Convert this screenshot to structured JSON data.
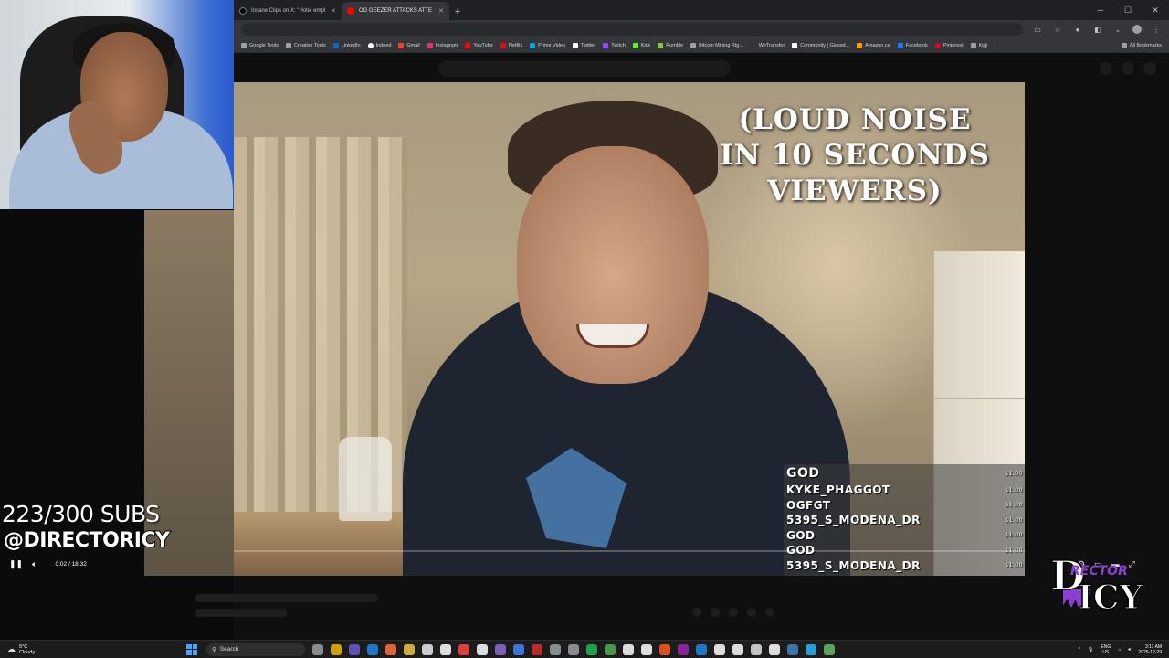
{
  "browser": {
    "tabs": [
      {
        "label": "Insane Clips on X: \"Hotel empl",
        "favicon_color": "#000000",
        "active": false
      },
      {
        "label": "OG GEEZER ATTACKS ATTE",
        "favicon_color": "#ff0000",
        "active": true
      }
    ],
    "new_tab": "+",
    "bookmarks": [
      {
        "label": "Google Tools",
        "color": "#9aa0a6"
      },
      {
        "label": "Creative Tools",
        "color": "#9aa0a6"
      },
      {
        "label": "LinkedIn",
        "color": "#0a66c2"
      },
      {
        "label": "Indeed",
        "color": "#ffffff"
      },
      {
        "label": "Gmail",
        "color": "#ea4335"
      },
      {
        "label": "Instagram",
        "color": "#e1306c"
      },
      {
        "label": "YouTube",
        "color": "#ff0000"
      },
      {
        "label": "Netflix",
        "color": "#e50914"
      },
      {
        "label": "Prime Video",
        "color": "#00a8e1"
      },
      {
        "label": "Twitter",
        "color": "#ffffff"
      },
      {
        "label": "Twitch",
        "color": "#9146ff"
      },
      {
        "label": "Kick",
        "color": "#53fc18"
      },
      {
        "label": "Rumble",
        "color": "#85c742"
      },
      {
        "label": "Bitcoin Mining Rig...",
        "color": "#9aa0a6"
      },
      {
        "label": "WeTransfer",
        "color": "#9aa0a6"
      },
      {
        "label": "Community | Glassd...",
        "color": "#ffffff"
      },
      {
        "label": "Amazon.ca",
        "color": "#ff9900"
      },
      {
        "label": "Facebook",
        "color": "#1877f2"
      },
      {
        "label": "Pinterest",
        "color": "#e60023"
      },
      {
        "label": "Kijiji",
        "color": "#9aa0a6"
      }
    ],
    "all_bookmarks": "All Bookmarks"
  },
  "video": {
    "overlay_text": "(LOUD NOISE IN 10 SECONDS VIEWERS)",
    "donations": [
      {
        "name": "GOD",
        "amount": "$1.00"
      },
      {
        "name": "KYKE_PHAGGOT",
        "amount": "$1.00"
      },
      {
        "name": "OGFGT",
        "amount": "$1.00"
      },
      {
        "name": "5395_S_MODENA_DR",
        "amount": "$1.00"
      },
      {
        "name": "GOD",
        "amount": "$1.00"
      },
      {
        "name": "GOD",
        "amount": "$1.00"
      },
      {
        "name": "5395_S_MODENA_DR",
        "amount": "$1.00"
      }
    ],
    "time": "0:02 / 18:32"
  },
  "stream": {
    "subs": "223/300 SUBS",
    "handle": "@DIRECTORICY",
    "brand_logo": "Director Icy logo (wordmark lettering: D RECTOR ICY)"
  },
  "taskbar": {
    "weather_temp": "5°C",
    "weather_desc": "Cloudy",
    "search_label": "Search",
    "lang_top": "ENG",
    "lang_bottom": "US",
    "time": "3:11 AM",
    "date": "2025-12-29",
    "app_colors": [
      "#9aa0a6",
      "#f2b600",
      "#6b5bd1",
      "#1e88e5",
      "#ff7139",
      "#f5c04a",
      "#e8eaed",
      "#ffffff",
      "#ff4444",
      "#ffffff",
      "#8e6bd1",
      "#4285f4",
      "#d32f2f",
      "#9aa0a6",
      "#9aa0a6",
      "#1db954",
      "#4caf50",
      "#ffffff",
      "#ffffff",
      "#ff5722",
      "#9c27b0",
      "#1e88e5",
      "#ffffff",
      "#ffffff",
      "#e0e0e0",
      "#ffffff",
      "#3d85c6",
      "#29b6f6",
      "#66bb6a"
    ]
  }
}
